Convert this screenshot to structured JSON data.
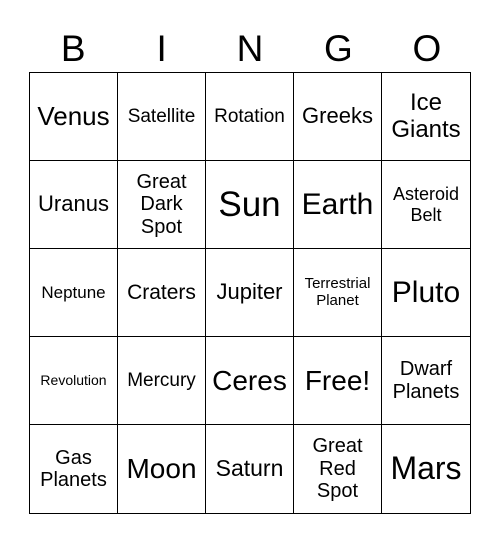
{
  "header": [
    "B",
    "I",
    "N",
    "G",
    "O"
  ],
  "cells": [
    {
      "text": "Venus",
      "size": 26
    },
    {
      "text": "Satellite",
      "size": 19
    },
    {
      "text": "Rotation",
      "size": 19
    },
    {
      "text": "Greeks",
      "size": 22
    },
    {
      "text": "Ice Giants",
      "size": 24
    },
    {
      "text": "Uranus",
      "size": 22
    },
    {
      "text": "Great Dark Spot",
      "size": 20
    },
    {
      "text": "Sun",
      "size": 35
    },
    {
      "text": "Earth",
      "size": 30
    },
    {
      "text": "Asteroid Belt",
      "size": 18
    },
    {
      "text": "Neptune",
      "size": 17
    },
    {
      "text": "Craters",
      "size": 21
    },
    {
      "text": "Jupiter",
      "size": 22
    },
    {
      "text": "Terrestrial Planet",
      "size": 15
    },
    {
      "text": "Pluto",
      "size": 30
    },
    {
      "text": "Revolution",
      "size": 14
    },
    {
      "text": "Mercury",
      "size": 19
    },
    {
      "text": "Ceres",
      "size": 28
    },
    {
      "text": "Free!",
      "size": 28
    },
    {
      "text": "Dwarf Planets",
      "size": 20
    },
    {
      "text": "Gas Planets",
      "size": 20
    },
    {
      "text": "Moon",
      "size": 28
    },
    {
      "text": "Saturn",
      "size": 23
    },
    {
      "text": "Great Red Spot",
      "size": 20
    },
    {
      "text": "Mars",
      "size": 32
    }
  ]
}
